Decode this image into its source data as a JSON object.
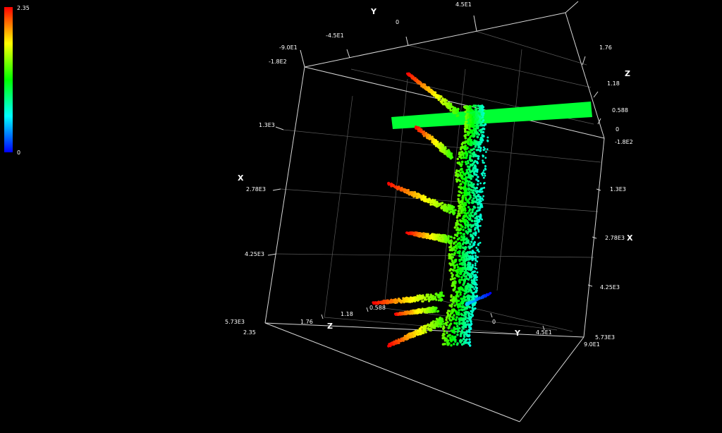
{
  "chart_data": {
    "type": "scatter",
    "subtype": "3d-point-cloud",
    "background": "#000000",
    "frame_color": "#cfcfcf",
    "color_scale": {
      "min_label": "0",
      "max_label": "2.35",
      "min": 0,
      "max": 2.35,
      "colors": [
        "#0000ff",
        "#00ffff",
        "#00ff00",
        "#ffff00",
        "#ff0000"
      ]
    },
    "axes": {
      "x": {
        "title": "X",
        "ticks": [
          "-1.8E2",
          "1.3E3",
          "2.78E3",
          "4.25E3",
          "5.73E3"
        ],
        "range": [
          -180,
          5730
        ]
      },
      "y": {
        "title": "Y",
        "ticks": [
          "-9.0E1",
          "-4.5E1",
          "0",
          "4.5E1",
          "9.0E1"
        ],
        "range": [
          -90,
          90
        ]
      },
      "z": {
        "title": "Z",
        "ticks": [
          "0",
          "0.588",
          "1.18",
          "1.76",
          "2.35"
        ],
        "range": [
          0,
          2.35
        ]
      }
    },
    "tick_groups": {
      "left_x": [
        "-1.8E2",
        "1.3E3",
        "2.78E3",
        "4.25E3",
        "5.73E3"
      ],
      "right_x": [
        "-1.8E2",
        "1.3E3",
        "2.78E3",
        "4.25E3",
        "5.73E3"
      ],
      "top_y": [
        "-9.0E1",
        "-4.5E1",
        "0",
        "4.5E1"
      ],
      "right_z": [
        "1.76",
        "1.18",
        "0.588",
        "0"
      ],
      "bottom_z": [
        "2.35",
        "1.76",
        "1.18",
        "0.588"
      ],
      "bottom_y": [
        "0",
        "4.5E1",
        "9.0E1"
      ]
    },
    "axis_titles": {
      "top_y": "Y",
      "right_z": "Z",
      "left_x": "X",
      "right_x": "X",
      "bottom_z": "Z",
      "bottom_y": "Y"
    },
    "grid": true
  }
}
